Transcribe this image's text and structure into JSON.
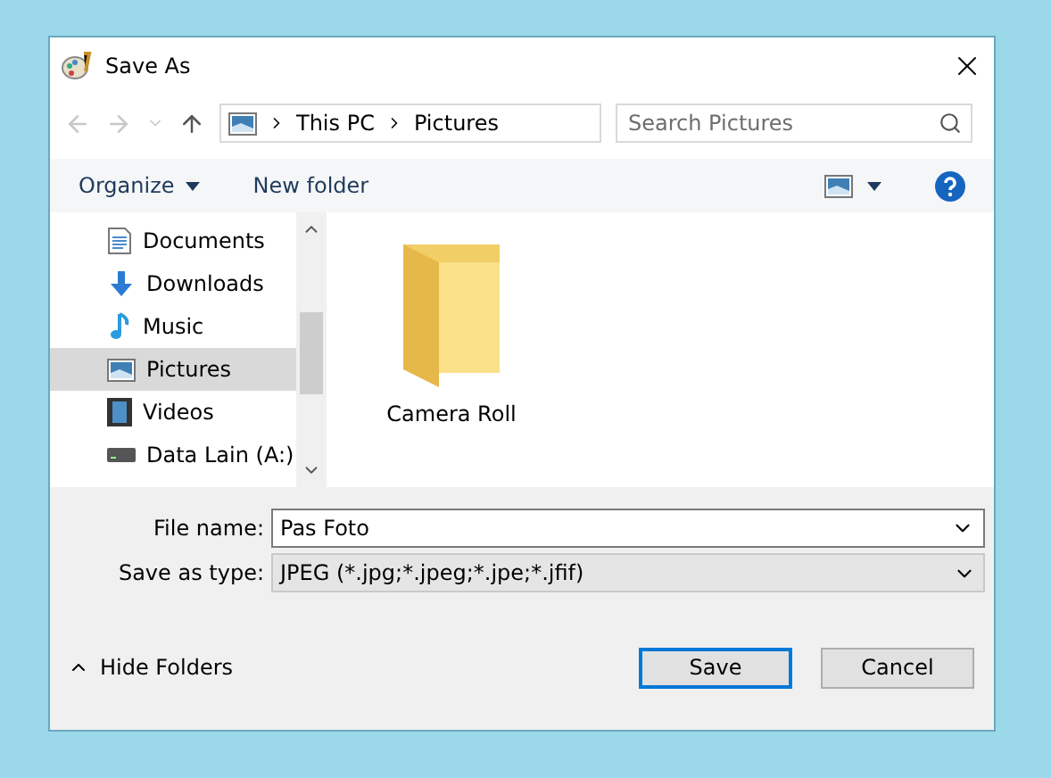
{
  "window": {
    "title": "Save As"
  },
  "breadcrumb": [
    "This PC",
    "Pictures"
  ],
  "search": {
    "placeholder": "Search Pictures"
  },
  "toolbar": {
    "organize": "Organize",
    "new_folder": "New folder"
  },
  "sidebar": {
    "items": [
      {
        "label": "Documents",
        "kind": "documents",
        "selected": false
      },
      {
        "label": "Downloads",
        "kind": "downloads",
        "selected": false
      },
      {
        "label": "Music",
        "kind": "music",
        "selected": false
      },
      {
        "label": "Pictures",
        "kind": "pictures",
        "selected": true
      },
      {
        "label": "Videos",
        "kind": "videos",
        "selected": false
      },
      {
        "label": "Data Lain (A:)",
        "kind": "drive",
        "selected": false
      }
    ]
  },
  "files": [
    {
      "name": "Camera Roll"
    }
  ],
  "file_name": {
    "label": "File name:",
    "value": "Pas Foto"
  },
  "save_type": {
    "label": "Save as type:",
    "value": "JPEG (*.jpg;*.jpeg;*.jpe;*.jfif)"
  },
  "hide_folders": "Hide Folders",
  "buttons": [
    {
      "label": "Save",
      "default": true
    },
    {
      "label": "Cancel",
      "default": false
    }
  ]
}
